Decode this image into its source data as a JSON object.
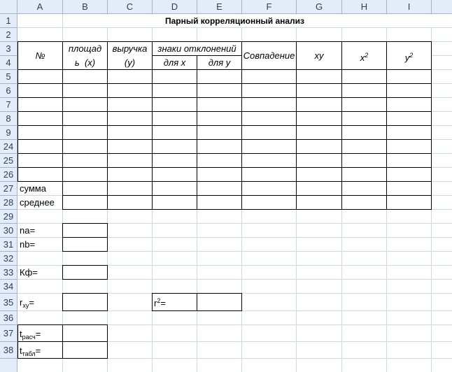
{
  "columns": [
    "A",
    "B",
    "C",
    "D",
    "E",
    "F",
    "G",
    "H",
    "I"
  ],
  "rows": [
    "1",
    "2",
    "3",
    "4",
    "5",
    "6",
    "7",
    "8",
    "9",
    "24",
    "25",
    "26",
    "27",
    "28",
    "29",
    "30",
    "31",
    "32",
    "33",
    "34",
    "35",
    "36",
    "37",
    "38"
  ],
  "title": "Парный корреляционный анализ",
  "table_headers": {
    "num": "№",
    "area_1": "площад",
    "area_2": "ь  (x)",
    "revenue_1": "выручка",
    "revenue_2": "(у)",
    "deviation_signs": "знаки отклонений",
    "for_x": "для х",
    "for_y": "для у",
    "match": "Совпадение",
    "xy": "ху",
    "x2_base": "х",
    "x2_exp": "2",
    "y2_base": "у",
    "y2_exp": "2"
  },
  "row_labels": {
    "sum": "сумма",
    "mean": "среднее",
    "na": "na=",
    "nb": "nb=",
    "kf": "Кф=",
    "rxy_base": "r",
    "rxy_sub": "xy",
    "rxy_eq": "=",
    "r2_base": "r",
    "r2_sup": "2",
    "r2_eq": "=",
    "t_calc_base": "t",
    "t_calc_sub": "расч",
    "t_calc_eq": "=",
    "t_table_base": "t",
    "t_table_sub": "табл",
    "t_table_eq": "="
  }
}
